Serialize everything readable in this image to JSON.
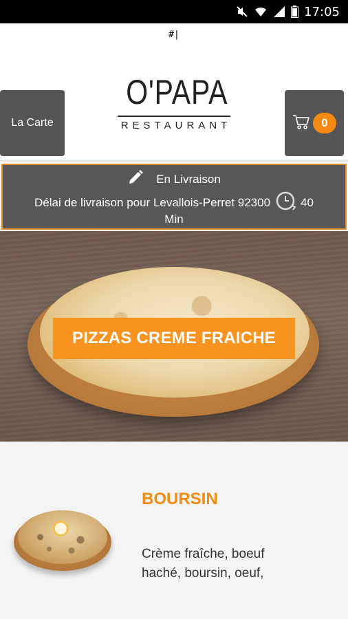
{
  "status_bar": {
    "time": "17:05",
    "icons": [
      "mute-icon",
      "wifi-icon",
      "signal-icon",
      "battery-icon"
    ]
  },
  "url_marker": "#|",
  "header": {
    "menu_button": "La Carte",
    "logo_main": "O'PAPA",
    "logo_sub": "RESTAURANT",
    "cart_count": "0"
  },
  "delivery": {
    "mode": "En Livraison",
    "delay_text": "Délai de livraison pour Levallois-Perret 92300",
    "delay_value": "40",
    "delay_unit": "Min"
  },
  "hero": {
    "category_label": "PIZZAS CREME FRAICHE"
  },
  "product": {
    "name": "BOURSIN",
    "description": "Crème fraîche, boeuf haché, boursin, oeuf,"
  },
  "colors": {
    "accent": "#f58a12",
    "button_bg": "#555555",
    "delivery_border": "#e0892a"
  }
}
